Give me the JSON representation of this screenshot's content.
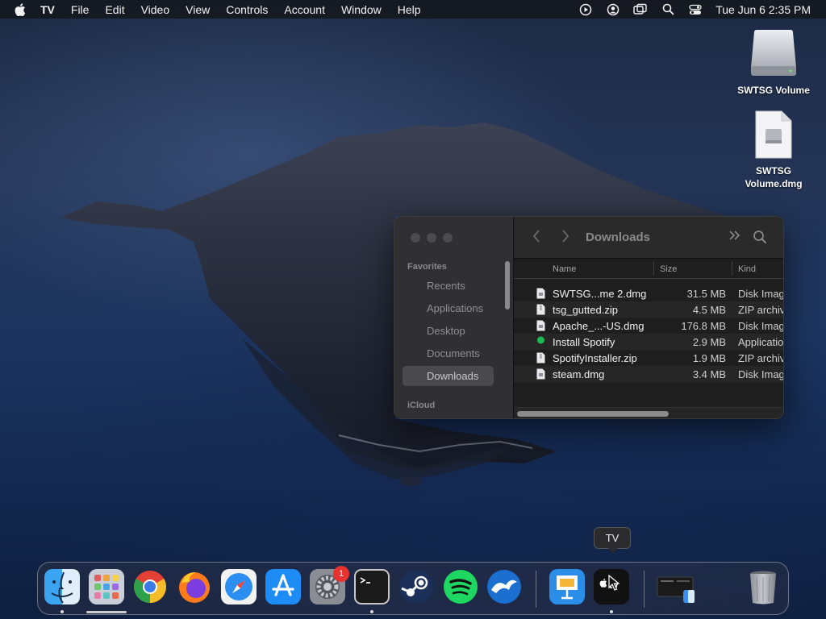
{
  "menubar": {
    "app_name": "TV",
    "items": [
      "File",
      "Edit",
      "Video",
      "View",
      "Controls",
      "Account",
      "Window",
      "Help"
    ],
    "clock": "Tue Jun 6  2:35 PM",
    "status_icons": [
      "play-circle-icon",
      "user-circle-icon",
      "screen-mirroring-icon",
      "search-icon",
      "control-center-icon"
    ]
  },
  "desktop": {
    "icons": [
      {
        "label": "SWTSG Volume",
        "icon": "drive-icon"
      },
      {
        "label": "SWTSG Volume.dmg",
        "icon": "dmg-file-icon"
      }
    ]
  },
  "finder": {
    "title": "Downloads",
    "sidebar": {
      "favorites_heading": "Favorites",
      "items": [
        "Recents",
        "Applications",
        "Desktop",
        "Documents",
        "Downloads"
      ],
      "active": "Downloads",
      "icloud_heading": "iCloud"
    },
    "columns": {
      "name": "Name",
      "size": "Size",
      "kind": "Kind"
    },
    "files": [
      {
        "name": "SWTSG...me 2.dmg",
        "size": "31.5 MB",
        "kind": "Disk Imag",
        "icon": "disk-image-icon"
      },
      {
        "name": "tsg_gutted.zip",
        "size": "4.5 MB",
        "kind": "ZIP archiv",
        "icon": "zip-file-icon"
      },
      {
        "name": "Apache_...-US.dmg",
        "size": "176.8 MB",
        "kind": "Disk Imag",
        "icon": "disk-image-icon"
      },
      {
        "name": "Install Spotify",
        "size": "2.9 MB",
        "kind": "Applicatio",
        "icon": "spotify-app-icon"
      },
      {
        "name": "SpotifyInstaller.zip",
        "size": "1.9 MB",
        "kind": "ZIP archiv",
        "icon": "zip-file-icon"
      },
      {
        "name": "steam.dmg",
        "size": "3.4 MB",
        "kind": "Disk Imag",
        "icon": "disk-image-icon"
      }
    ]
  },
  "tooltip": {
    "text": "TV"
  },
  "dock": {
    "apps": [
      {
        "name": "Finder",
        "icon": "finder-icon",
        "running": true
      },
      {
        "name": "Launchpad",
        "icon": "launchpad-icon",
        "running": false
      },
      {
        "name": "Google Chrome",
        "icon": "chrome-icon",
        "running": false
      },
      {
        "name": "Firefox",
        "icon": "firefox-icon",
        "running": false
      },
      {
        "name": "Safari",
        "icon": "safari-icon",
        "running": false
      },
      {
        "name": "App Store",
        "icon": "app-store-icon",
        "running": false
      },
      {
        "name": "System Preferences",
        "icon": "system-preferences-icon",
        "running": false,
        "badge": "1"
      },
      {
        "name": "Terminal",
        "icon": "terminal-icon",
        "running": true
      },
      {
        "name": "Steam",
        "icon": "steam-icon",
        "running": false
      },
      {
        "name": "Spotify",
        "icon": "spotify-icon",
        "running": false
      },
      {
        "name": "OpenOffice",
        "icon": "openoffice-icon",
        "running": false
      },
      {
        "name": "Keynote",
        "icon": "keynote-icon",
        "running": false
      },
      {
        "name": "TV",
        "icon": "tv-icon",
        "running": true
      },
      {
        "name": "Downloads Stack",
        "icon": "downloads-stack-icon",
        "running": false
      },
      {
        "name": "Trash",
        "icon": "trash-icon",
        "running": false
      }
    ],
    "tv_label": "tv"
  }
}
